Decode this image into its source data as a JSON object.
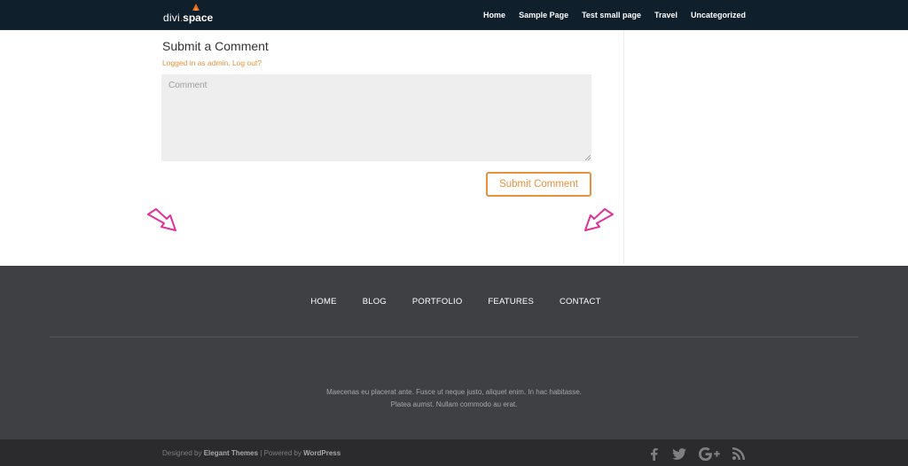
{
  "header": {
    "logo": {
      "divi": "divi",
      "dot": ".",
      "space": "space"
    },
    "nav": [
      "Home",
      "Sample Page",
      "Test small page",
      "Travel",
      "Uncategorized"
    ]
  },
  "comments": {
    "title": "Submit a Comment",
    "logged_in_as": "Logged in as admin.",
    "logout": "Log out?",
    "comment_placeholder": "Comment",
    "comment_value": "",
    "submit_label": "Submit Comment"
  },
  "annotation_arrows": [
    "arrow-pointing-down-right",
    "arrow-pointing-down-left"
  ],
  "footer": {
    "nav": [
      "HOME",
      "BLOG",
      "PORTFOLIO",
      "FEATURES",
      "CONTACT"
    ],
    "text_line1": "Maecenas eu placerat ante. Fusce ut neque justo, aliquet enim. In hac habitasse.",
    "text_line2": "Platea aumst. Nullam commodo au erat."
  },
  "bottom_bar": {
    "designed_by_prefix": "Designed by",
    "designed_by": "Elegant Themes",
    "separator": "|",
    "powered_by_prefix": "Powered by",
    "powered_by": "WordPress",
    "social_icons": [
      "facebook-icon",
      "twitter-icon",
      "google-plus-icon",
      "rss-icon"
    ]
  },
  "colors": {
    "accent": "#e8913c",
    "navbar_bg": "#0f1f2b",
    "footer_bg": "#3f4044",
    "bottombar_bg": "#2b2b2e",
    "arrow": "#e0309a"
  }
}
